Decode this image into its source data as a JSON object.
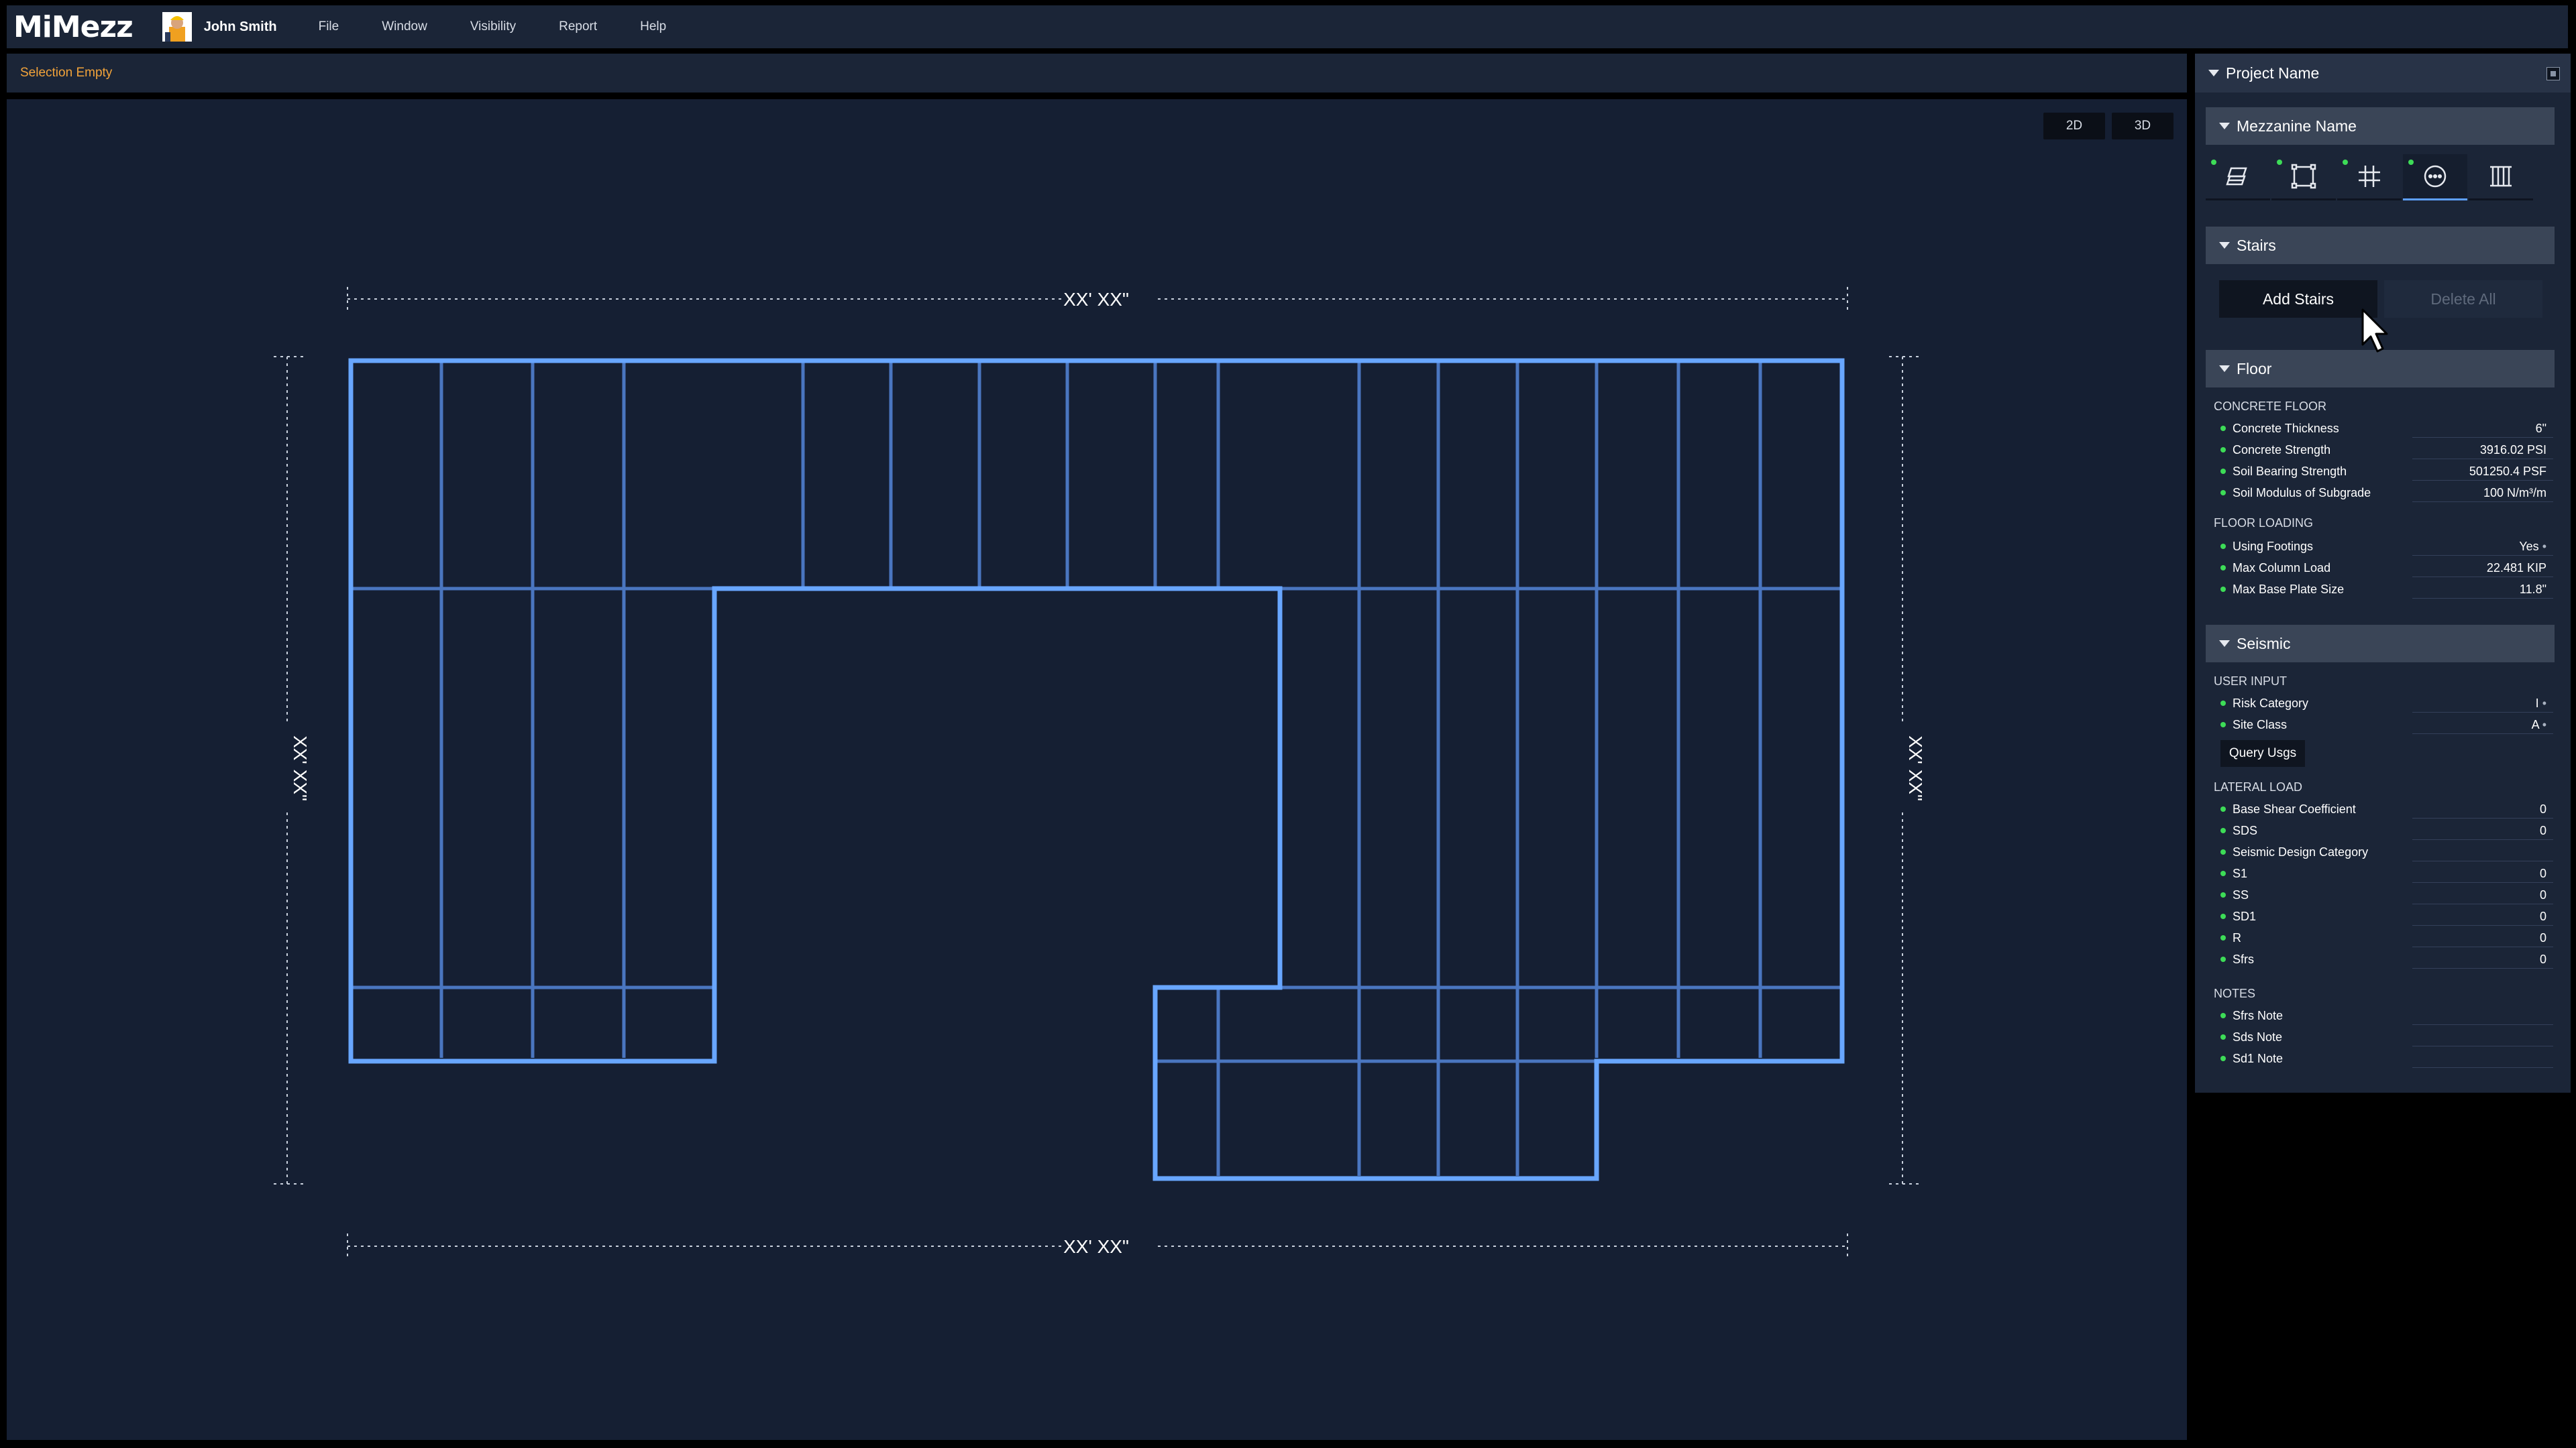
{
  "app": {
    "logo": "MiMezz",
    "user_name": "John Smith",
    "menu": [
      "File",
      "Window",
      "Visibility",
      "Report",
      "Help"
    ]
  },
  "status": {
    "selection": "Selection Empty"
  },
  "canvas": {
    "view_2d": "2D",
    "view_3d": "3D",
    "dim_top": "XX' XX\"",
    "dim_bottom": "XX' XX\"",
    "dim_left": "XX' XX\"",
    "dim_right": "XX' XX\""
  },
  "panel": {
    "project_name": "Project Name",
    "mezzanine_name": "Mezzanine Name",
    "tools": [
      {
        "icon": "layers-icon",
        "has_dot": true
      },
      {
        "icon": "rectangle-icon",
        "has_dot": true
      },
      {
        "icon": "grid-icon",
        "has_dot": true
      },
      {
        "icon": "more-circle-icon",
        "has_dot": true
      },
      {
        "icon": "railing-icon",
        "has_dot": false
      }
    ],
    "stairs": {
      "title": "Stairs",
      "add_label": "Add Stairs",
      "delete_label": "Delete All"
    },
    "floor": {
      "title": "Floor",
      "concrete_label": "CONCRETE FLOOR",
      "concrete_rows": [
        {
          "label": "Concrete Thickness",
          "value": "6\""
        },
        {
          "label": "Concrete Strength",
          "value": "3916.02 PSI"
        },
        {
          "label": "Soil Bearing Strength",
          "value": "501250.4 PSF"
        },
        {
          "label": "Soil Modulus of Subgrade",
          "value": "100 N/m³/m"
        }
      ],
      "loading_label": "FLOOR LOADING",
      "loading_rows": [
        {
          "label": "Using Footings",
          "value": "Yes"
        },
        {
          "label": "Max Column Load",
          "value": "22.481 KIP"
        },
        {
          "label": "Max Base Plate Size",
          "value": "11.8\""
        }
      ]
    },
    "seismic": {
      "title": "Seismic",
      "user_input_label": "USER INPUT",
      "user_rows": [
        {
          "label": "Risk Category",
          "value": "I"
        },
        {
          "label": "Site Class",
          "value": "A"
        }
      ],
      "query_label": "Query Usgs",
      "lateral_label": "LATERAL LOAD",
      "lateral_rows": [
        {
          "label": "Base Shear Coefficient",
          "value": "0"
        },
        {
          "label": "SDS",
          "value": "0"
        },
        {
          "label": "Seismic Design Category",
          "value": ""
        },
        {
          "label": "S1",
          "value": "0"
        },
        {
          "label": "SS",
          "value": "0"
        },
        {
          "label": "SD1",
          "value": "0"
        },
        {
          "label": "R",
          "value": "0"
        },
        {
          "label": "Sfrs",
          "value": "0"
        }
      ],
      "notes_label": "NOTES",
      "notes_rows": [
        {
          "label": "Sfrs Note",
          "value": ""
        },
        {
          "label": "Sds Note",
          "value": ""
        },
        {
          "label": "Sd1 Note",
          "value": ""
        }
      ]
    }
  },
  "colors": {
    "accent": "#5ea0ff",
    "status": "#f2a33a",
    "ok_dot": "#3ddc57",
    "canvas_bg": "#151f33"
  }
}
